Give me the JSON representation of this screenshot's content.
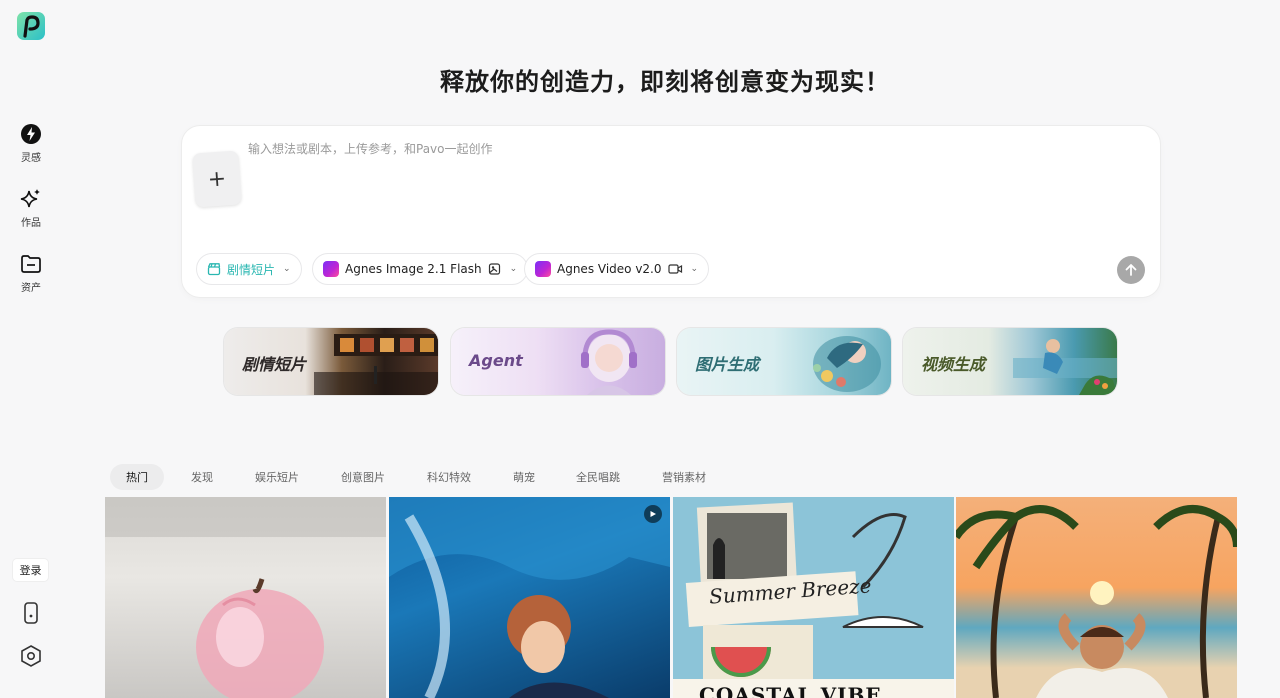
{
  "sidebar": {
    "nav": [
      {
        "label": "灵感",
        "icon": "bolt-icon"
      },
      {
        "label": "作品",
        "icon": "sparkle-icon"
      },
      {
        "label": "资产",
        "icon": "folder-icon"
      }
    ],
    "login_label": "登录"
  },
  "headline": "释放你的创造力，即刻将创意变为现实！",
  "composer": {
    "placeholder": "输入想法或剧本，上传参考，和Pavo一起创作",
    "upload_symbol": "+",
    "chips": [
      {
        "label": "剧情短片"
      },
      {
        "label": "Agnes Image 2.1 Flash"
      },
      {
        "label": "Agnes Video v2.0"
      }
    ]
  },
  "feature_cards": [
    {
      "label": "剧情短片",
      "color": "#2f2a2a"
    },
    {
      "label": "Agent",
      "color": "#6b4a8a"
    },
    {
      "label": "图片生成",
      "color": "#2f6e74"
    },
    {
      "label": "视频生成",
      "color": "#4a5a2a"
    }
  ],
  "tabs": [
    "热门",
    "发现",
    "娱乐短片",
    "创意图片",
    "科幻特效",
    "萌宠",
    "全民唱跳",
    "营销素材"
  ],
  "gallery": {
    "tile3_title": "Summer Breeze",
    "tile3_subtitle": "COASTAL VIBE"
  },
  "colors": {
    "accent": "#2ab7b1",
    "send": "#a8a8a8"
  }
}
